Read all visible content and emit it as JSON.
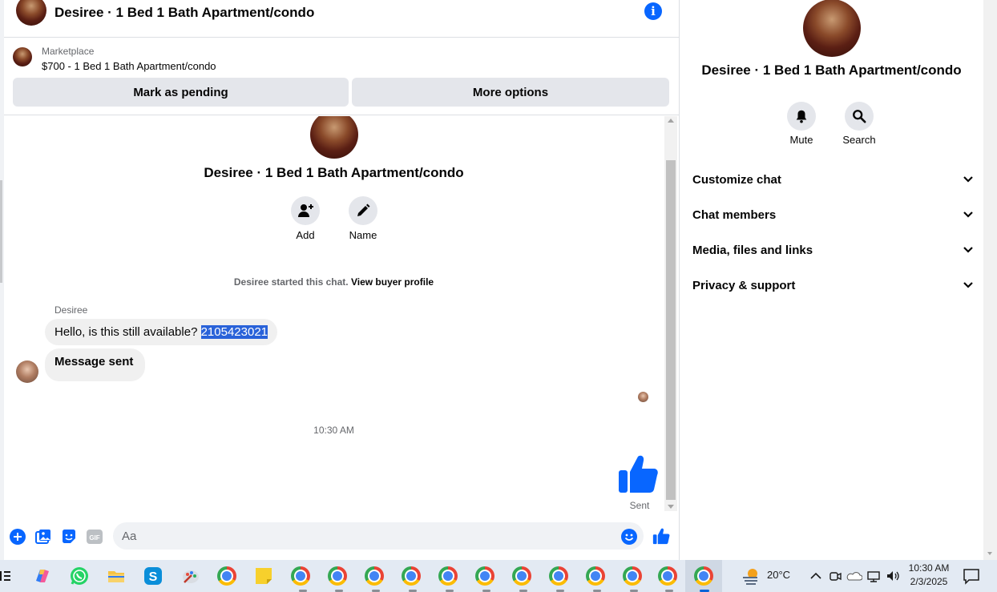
{
  "header": {
    "title": "Desiree · 1 Bed 1 Bath Apartment/condo"
  },
  "marketplace": {
    "label": "Marketplace",
    "listing": "$700 - 1 Bed 1 Bath Apartment/condo",
    "pending_button": "Mark as pending",
    "more_button": "More options"
  },
  "conversation": {
    "title": "Desiree · 1 Bed 1 Bath Apartment/condo",
    "add_label": "Add",
    "name_label": "Name",
    "started_text": "Desiree started this chat.",
    "buyer_link": "View buyer profile",
    "sender_name": "Desiree",
    "message_1_text": "Hello, is this still available? ",
    "message_1_selected": "2105423021",
    "message_2_text": "Message sent",
    "timestamp": "10:30 AM",
    "sent_status": "Sent"
  },
  "composer": {
    "placeholder": "Aa"
  },
  "info_panel": {
    "title": "Desiree · 1 Bed 1 Bath Apartment/condo",
    "mute_label": "Mute",
    "search_label": "Search",
    "sections": [
      {
        "label": "Customize chat"
      },
      {
        "label": "Chat members"
      },
      {
        "label": "Media, files and links"
      },
      {
        "label": "Privacy & support"
      }
    ]
  },
  "taskbar": {
    "temperature": "20°C",
    "time": "10:30 AM",
    "date": "2/3/2025"
  },
  "colors": {
    "accent": "#0866ff",
    "bubble": "#f0f0f0",
    "selection": "#2962d9",
    "button_bg": "#e4e6eb"
  }
}
